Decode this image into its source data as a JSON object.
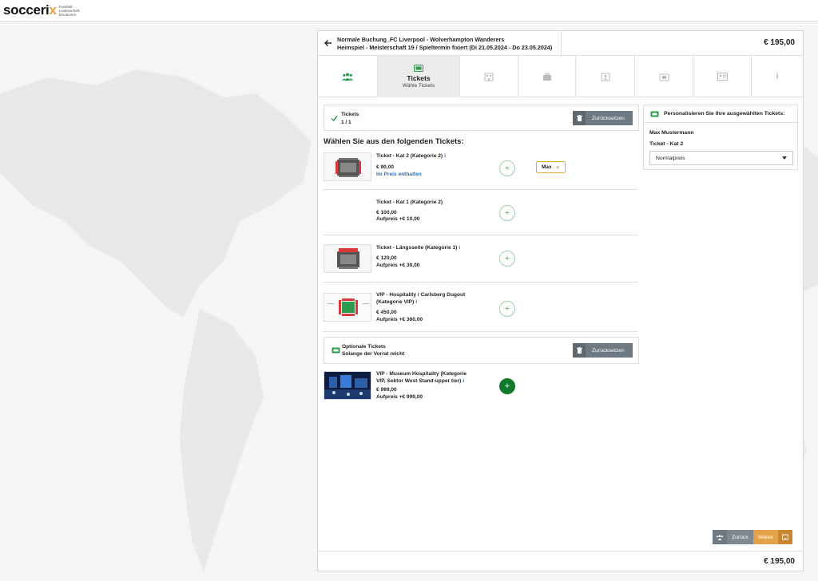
{
  "brand": {
    "name_main": "socceri",
    "name_accent": "x",
    "tagline": [
      "Fussball.",
      "Leidenschaft.",
      "Emotionen."
    ]
  },
  "header": {
    "title_line1": "Normale Buchung_FC Liverpool - Wolverhampton Wanderers",
    "title_line2": "Heimspiel - Meisterschaft 19 / Spieltermin fixiert (Di 21.05.2024 - Do 23.05.2024)",
    "price": "€ 195,00"
  },
  "steps": [
    {
      "icon": "people-icon"
    },
    {
      "icon": "ticket-icon",
      "label": "Tickets",
      "sub": "Wähle Tickets",
      "active": true
    },
    {
      "icon": "hotel-icon"
    },
    {
      "icon": "luggage-icon"
    },
    {
      "icon": "person-card-icon"
    },
    {
      "icon": "camera-icon"
    },
    {
      "icon": "id-card-icon"
    },
    {
      "icon": "info-icon",
      "text": "i"
    }
  ],
  "summary": {
    "label": "Tickets",
    "count": "1 / 1",
    "reset_label": "Zurücksetzen"
  },
  "section_title": "Wählen Sie aus den folgenden Tickets:",
  "tickets": [
    {
      "name": "Ticket - Kat 2 (Kategorie 2)",
      "info": "i",
      "price": "€ 90,00",
      "extra": "Im Preis enthalten",
      "chip": "Max"
    },
    {
      "name": "Ticket - Kat 1 (Kategorie 2)",
      "price": "€ 100,00",
      "extra": "Aufpreis +€ 10,00"
    },
    {
      "name": "Ticket - Längsseite (Kategorie 1)",
      "info": "i",
      "price": "€ 120,00",
      "extra": "Aufpreis +€ 30,00"
    },
    {
      "name_line1": "VIP - Hospitality / Carlsberg Dugout",
      "name_line2": "(Kategorie VIP)",
      "info": "i",
      "price": "€ 450,00",
      "extra": "Aufpreis +€ 360,00"
    }
  ],
  "optional": {
    "label": "Optionale Tickets",
    "sub": "Solange der Vorrat reicht",
    "reset_label": "Zurücksetzen"
  },
  "optional_ticket": {
    "name_line1": "VIP - Museum Hospitality (Kategorie",
    "name_line2": "VIP, Sektor West Stand-upper tier)",
    "info": "i",
    "price": "€ 999,00",
    "extra": "Aufpreis +€ 999,00"
  },
  "personalize": {
    "title": "Personalisieren Sie Ihre ausgewählten Tickets:",
    "person": "Max Mustermann",
    "ticket": "Ticket - Kat 2",
    "select_value": "Normalpreis"
  },
  "nav": {
    "back": "Zurück",
    "next": "Weiter"
  },
  "footer": {
    "price": "€ 195,00"
  },
  "colors": {
    "accent_green": "#0f7a2e",
    "accent_orange": "#e3a24a",
    "info_blue": "#2a6fb5",
    "button_gray": "#6d7983"
  }
}
